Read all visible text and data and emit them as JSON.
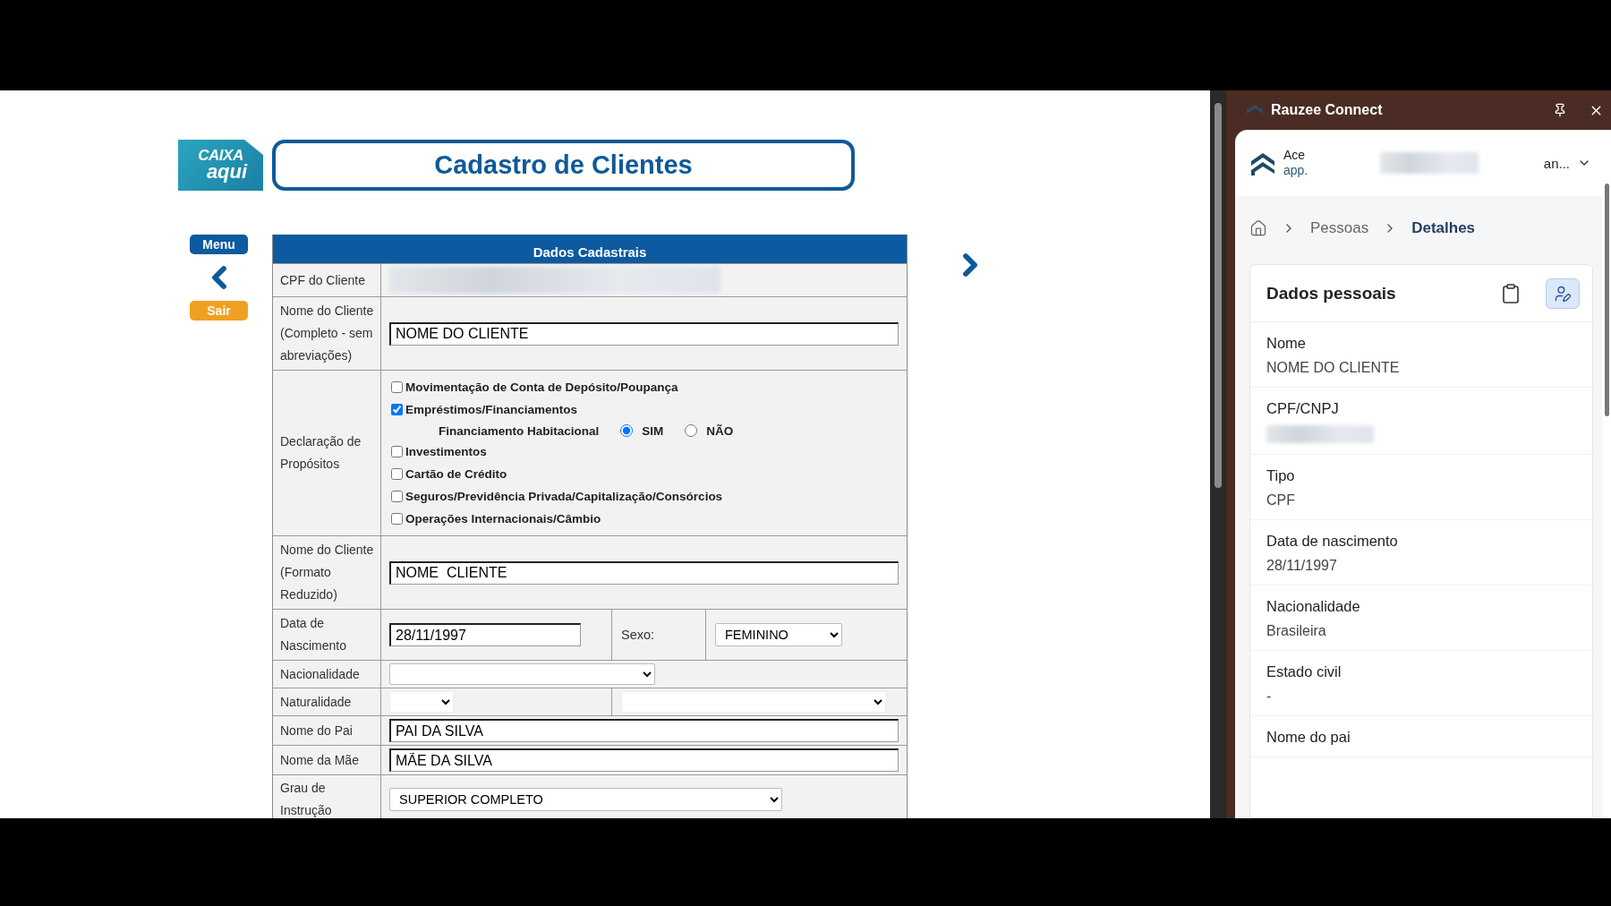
{
  "page": {
    "logo": {
      "line1": "CAIXA",
      "line2": "aqui"
    },
    "title": "Cadastro de Clientes",
    "nav": {
      "menu": "Menu",
      "exit": "Sair"
    }
  },
  "form": {
    "header": "Dados Cadastrais",
    "rows": [
      {
        "kind": "redacted",
        "label": "CPF do Cliente"
      },
      {
        "kind": "text",
        "label": "Nome do Cliente (Completo - sem abreviações)",
        "value": "NOME DO CLIENTE"
      },
      {
        "kind": "checklist",
        "label": "Declaração de Propósitos",
        "options": [
          {
            "label": "Movimentação de Conta de Depósito/Poupança",
            "checked": false
          },
          {
            "label": "Empréstimos/Financiamentos",
            "checked": true,
            "sub": {
              "label": "Financiamento Habitacional",
              "choices": [
                {
                  "label": "SIM",
                  "selected": true
                },
                {
                  "label": "NÃO",
                  "selected": false
                }
              ]
            }
          },
          {
            "label": "Investimentos",
            "checked": false
          },
          {
            "label": "Cartão de Crédito",
            "checked": false
          },
          {
            "label": "Seguros/Previdência Privada/Capitalização/Consórcios",
            "checked": false
          },
          {
            "label": "Operações Internacionais/Câmbio",
            "checked": false
          }
        ]
      },
      {
        "kind": "text",
        "label": "Nome do Cliente (Formato Reduzido)",
        "value": "NOME  CLIENTE"
      },
      {
        "kind": "date_sex",
        "label": "Data de Nascimento",
        "value": "28/11/1997",
        "extra_label": "Sexo:",
        "extra_value": "FEMININO"
      },
      {
        "kind": "select",
        "label": "Nacionalidade"
      },
      {
        "kind": "double_select",
        "label": "Naturalidade"
      },
      {
        "kind": "text",
        "label": "Nome do Pai",
        "value": "PAI DA SILVA"
      },
      {
        "kind": "text",
        "label": "Nome da Mãe",
        "value": "MÃE DA SILVA"
      },
      {
        "kind": "select",
        "label": "Grau de Instrução",
        "value": "SUPERIOR COMPLETO"
      }
    ]
  },
  "panel": {
    "title": "Rauzee Connect",
    "account": {
      "name": "Ace",
      "url": "app.",
      "suffix": "an..."
    },
    "breadcrumb": [
      {
        "label": "Pessoas",
        "current": false
      },
      {
        "label": "Detalhes",
        "current": true
      }
    ],
    "card_title": "Dados pessoais",
    "fields": [
      {
        "label": "Nome",
        "value": "NOME DO CLIENTE"
      },
      {
        "label": "CPF/CNPJ",
        "redacted": true
      },
      {
        "label": "Tipo",
        "value": "CPF"
      },
      {
        "label": "Data de nascimento",
        "value": "28/11/1997"
      },
      {
        "label": "Nacionalidade",
        "value": "Brasileira"
      },
      {
        "label": "Estado civil",
        "value": "-"
      },
      {
        "label": "Nome do pai"
      }
    ]
  }
}
